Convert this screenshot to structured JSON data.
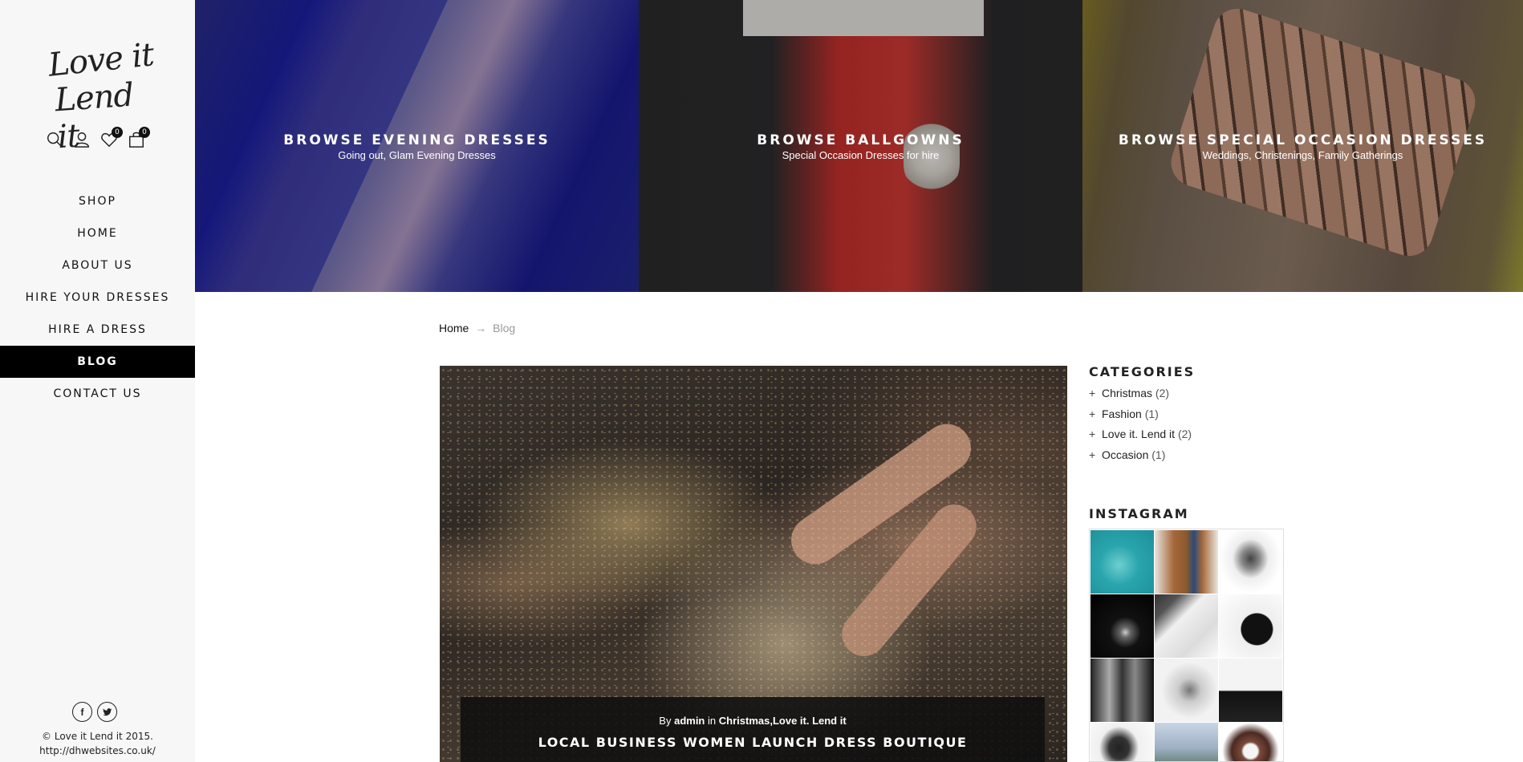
{
  "sidebar": {
    "logo": {
      "line1": "Love it",
      "line2": "Lend it"
    },
    "icons": [
      {
        "name": "search-icon"
      },
      {
        "name": "user-icon"
      },
      {
        "name": "heart-icon",
        "badge": "0"
      },
      {
        "name": "bag-icon",
        "badge": "0"
      }
    ],
    "nav": [
      {
        "label": "SHOP"
      },
      {
        "label": "HOME"
      },
      {
        "label": "ABOUT US"
      },
      {
        "label": "HIRE YOUR DRESSES"
      },
      {
        "label": "HIRE A DRESS"
      },
      {
        "label": "BLOG",
        "active": true
      },
      {
        "label": "CONTACT US"
      }
    ],
    "social": {
      "facebook": "f",
      "twitter": "t"
    },
    "copyright": {
      "line1": "© Love it Lend it 2015.",
      "line2": "http://dhwebsites.co.uk/"
    }
  },
  "banners": [
    {
      "title": "BROWSE EVENING DRESSES",
      "subtitle": "Going out, Glam Evening Dresses"
    },
    {
      "title": "BROWSE BALLGOWNS",
      "subtitle": "Special Occasion Dresses for hire"
    },
    {
      "title": "BROWSE SPECIAL OCCASION DRESSES",
      "subtitle": "Weddings, Christenings, Family Gatherings"
    }
  ],
  "breadcrumb": {
    "home": "Home",
    "separator": "→",
    "current": "Blog"
  },
  "post": {
    "by_label": "By",
    "author": "admin",
    "in_label": "in",
    "categories": "Christmas,Love it. Lend it",
    "title": "LOCAL BUSINESS WOMEN LAUNCH DRESS BOUTIQUE"
  },
  "categories_widget": {
    "title": "CATEGORIES",
    "items": [
      {
        "name": "Christmas",
        "count": "(2)"
      },
      {
        "name": "Fashion",
        "count": "(1)"
      },
      {
        "name": "Love it. Lend it",
        "count": "(2)"
      },
      {
        "name": "Occasion",
        "count": "(1)"
      }
    ]
  },
  "instagram_widget": {
    "title": "INSTAGRAM"
  }
}
